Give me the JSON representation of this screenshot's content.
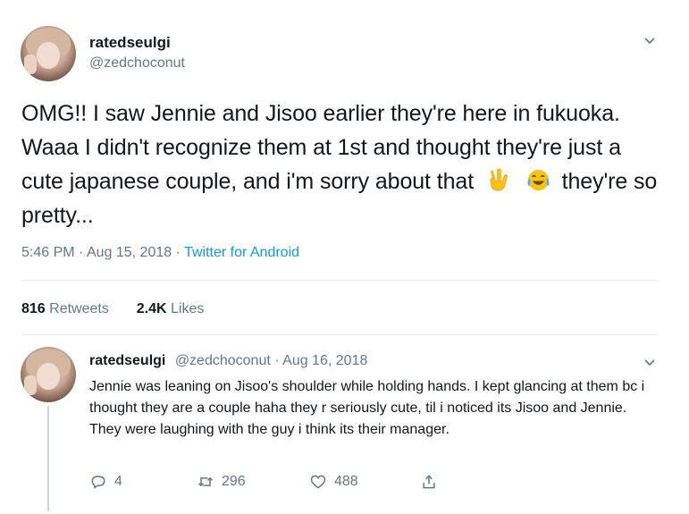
{
  "tweet": {
    "display_name": "ratedseulgi",
    "handle": "@zedchoconut",
    "text_part1": "OMG!! I saw Jennie and Jisoo earlier they're here in fukuoka. Waaa I didn't recognize them at 1st and thought they're just a cute japanese couple, and i'm sorry about that",
    "text_part2": "they're so pretty...",
    "emojis": [
      "victory-hand-icon",
      "tears-of-joy-icon"
    ],
    "time": "5:46 PM",
    "date": "Aug 15, 2018",
    "separator": "·",
    "source": "Twitter for Android",
    "source_color": "#1b95e0",
    "retweets_count": "816",
    "retweets_label": "Retweets",
    "likes_count": "2.4K",
    "likes_label": "Likes"
  },
  "reply": {
    "display_name": "ratedseulgi",
    "handle": "@zedchoconut",
    "separator": "·",
    "date": "Aug 16, 2018",
    "text": "Jennie was leaning on Jisoo's shoulder while holding hands. I kept glancing at them bc i thought they are a couple haha they r seriously cute, til i noticed its Jisoo and Jennie. They were laughing with the guy i think its their manager.",
    "reply_count": "4",
    "retweet_count": "296",
    "like_count": "488"
  },
  "colors": {
    "text": "#14171a",
    "secondary": "#657786",
    "divider": "#e6ecf0"
  }
}
